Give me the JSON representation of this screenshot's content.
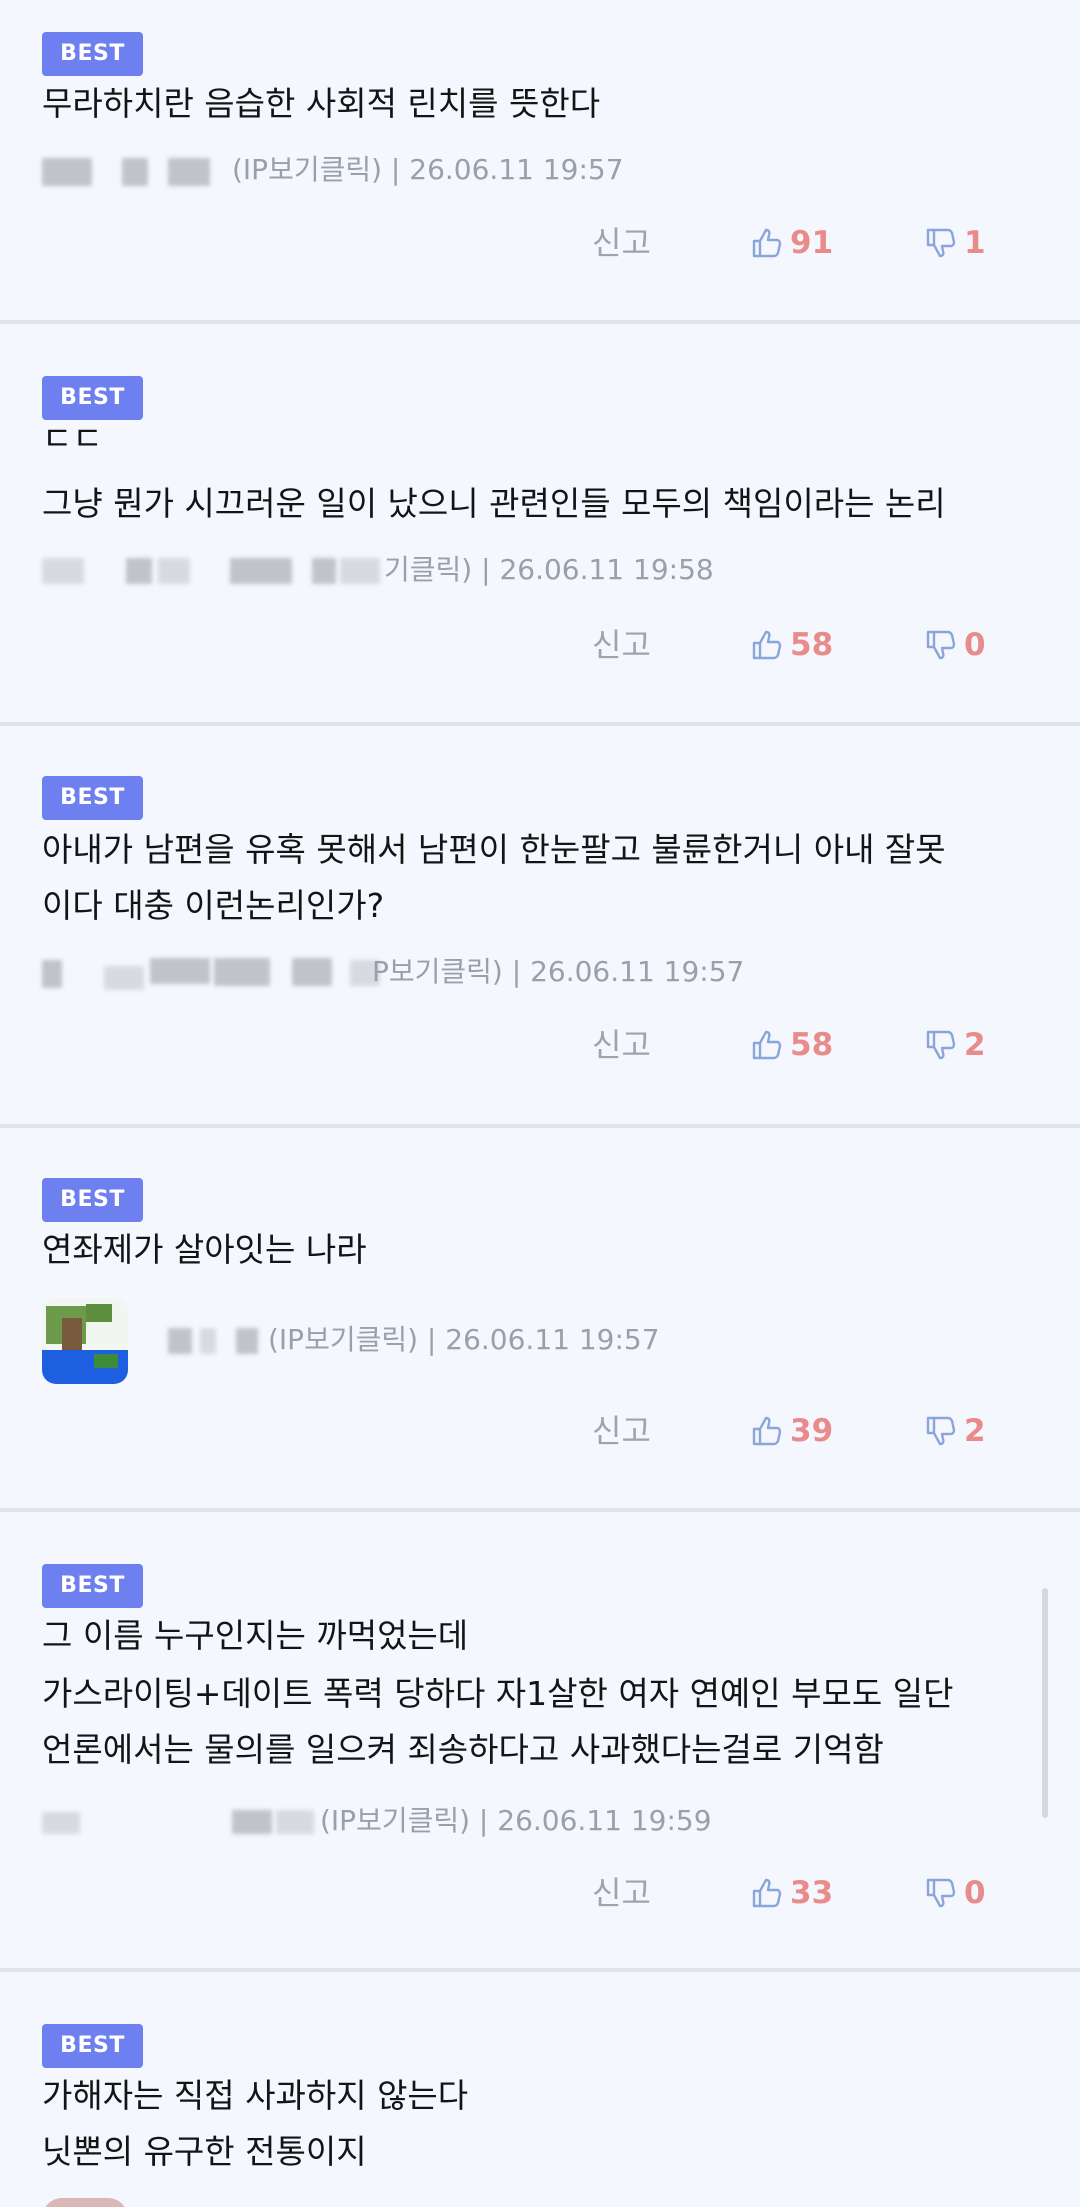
{
  "comments": [
    {
      "badge": "BEST",
      "lines": [
        "무라하치란 음습한 사회적 린치를 뜻한다"
      ],
      "meta": "(IP보기클릭) | 26.06.11 19:57",
      "report": "신고",
      "likes": "91",
      "dislikes": "1"
    },
    {
      "badge": "BEST",
      "lines": [
        "ㄷㄷ",
        "그냥 뭔가 시끄러운 일이 났으니 관련인들 모두의 책임이라는 논리"
      ],
      "meta": "기클릭) | 26.06.11 19:58",
      "report": "신고",
      "likes": "58",
      "dislikes": "0"
    },
    {
      "badge": "BEST",
      "lines": [
        "아내가 남편을 유혹 못해서 남편이 한눈팔고 불륜한거니 아내 잘못",
        "이다 대충 이런논리인가?"
      ],
      "meta": "P보기클릭) | 26.06.11 19:57",
      "report": "신고",
      "likes": "58",
      "dislikes": "2"
    },
    {
      "badge": "BEST",
      "lines": [
        "연좌제가 살아잇는 나라"
      ],
      "meta": "(IP보기클릭) | 26.06.11 19:57",
      "report": "신고",
      "likes": "39",
      "dislikes": "2"
    },
    {
      "badge": "BEST",
      "lines": [
        "그 이름 누구인지는 까먹었는데",
        "가스라이팅+데이트 폭력 당하다 자1살한 여자 연예인 부모도 일단",
        "언론에서는 물의를 일으켜 죄송하다고 사과했다는걸로 기억함"
      ],
      "meta": "(IP보기클릭) | 26.06.11 19:59",
      "report": "신고",
      "likes": "33",
      "dislikes": "0"
    },
    {
      "badge": "BEST",
      "lines": [
        "가해자는 직접 사과하지 않는다",
        "닛뽄의 유구한 전통이지"
      ]
    }
  ],
  "icons": {
    "like": "thumbs-up-icon",
    "dislike": "thumbs-down-icon"
  },
  "colors": {
    "badge": "#6e7ff0",
    "count": "#ea8b8b",
    "thumb": "#8aa4dc",
    "background": "#f4f7fd"
  }
}
